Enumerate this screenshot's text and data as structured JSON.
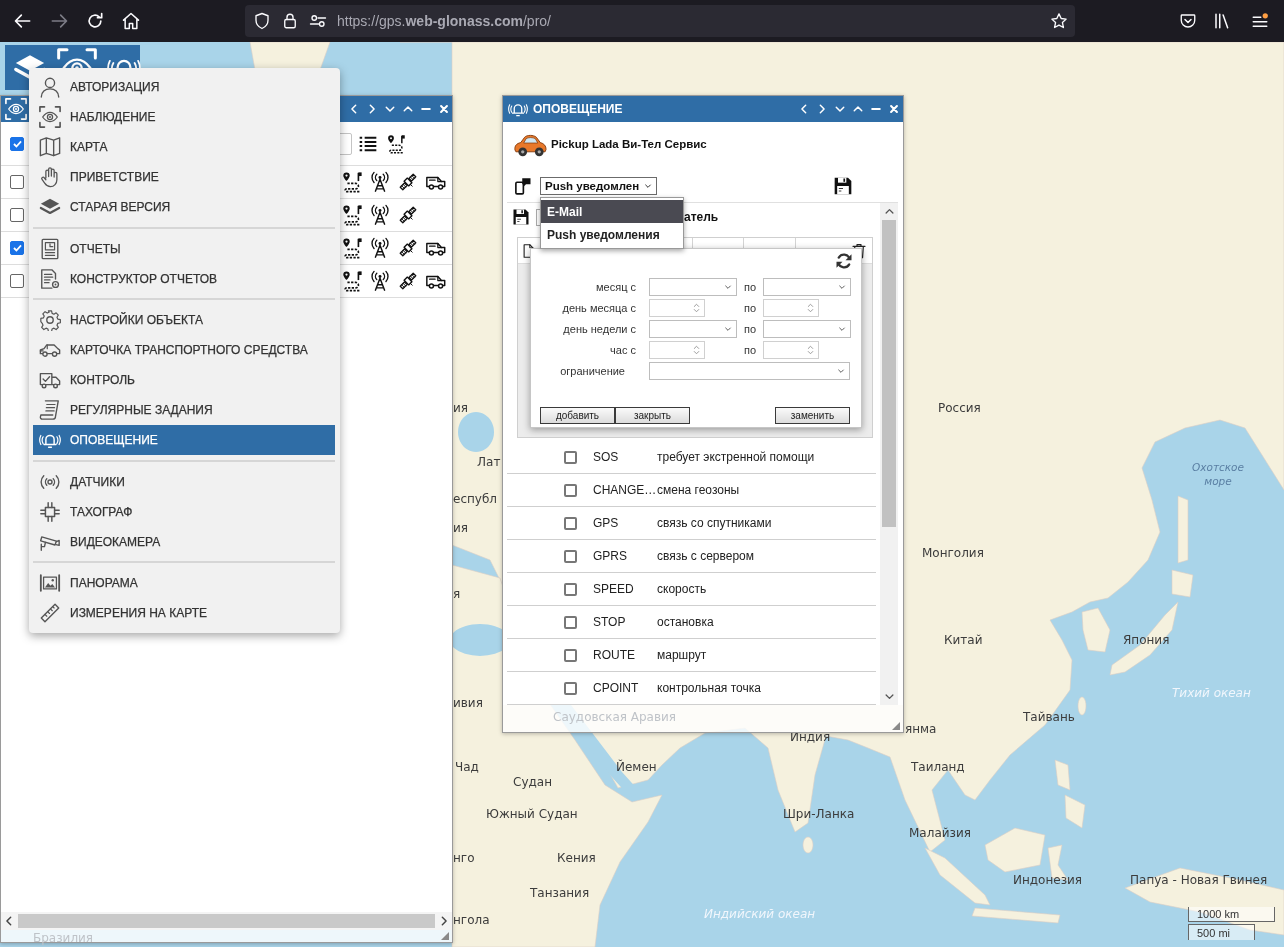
{
  "browser": {
    "url": "https://gps.**web-glonass.com**/pro/"
  },
  "objects_window": {
    "all_checked": true,
    "rows": [
      {
        "checked": false,
        "vehicle": true
      },
      {
        "checked": false,
        "vehicle": false
      },
      {
        "checked": true,
        "vehicle": true
      },
      {
        "checked": false,
        "vehicle": true
      }
    ]
  },
  "menu": {
    "groups": [
      {
        "items": [
          {
            "label": "АВТОРИЗАЦИЯ",
            "selected": false
          },
          {
            "label": "НАБЛЮДЕНИЕ",
            "selected": false
          },
          {
            "label": "КАРТА",
            "selected": false
          },
          {
            "label": "ПРИВЕТСТВИЕ",
            "selected": false
          },
          {
            "label": "СТАРАЯ ВЕРСИЯ",
            "selected": false
          }
        ]
      },
      {
        "items": [
          {
            "label": "ОТЧЕТЫ",
            "selected": false
          },
          {
            "label": "КОНСТРУКТОР ОТЧЕТОВ",
            "selected": false
          }
        ]
      },
      {
        "items": [
          {
            "label": "НАСТРОЙКИ ОБЪЕКТА",
            "selected": false
          },
          {
            "label": "КАРТОЧКА ТРАНСПОРТНОГО СРЕДСТВА",
            "selected": false
          },
          {
            "label": "КОНТРОЛЬ",
            "selected": false
          },
          {
            "label": "РЕГУЛЯРНЫЕ ЗАДАНИЯ",
            "selected": false
          },
          {
            "label": "ОПОВЕЩЕНИЕ",
            "selected": true
          }
        ]
      },
      {
        "items": [
          {
            "label": "ДАТЧИКИ",
            "selected": false
          },
          {
            "label": "ТАХОГРАФ",
            "selected": false
          },
          {
            "label": "ВИДЕОКАМЕРА",
            "selected": false
          }
        ]
      },
      {
        "items": [
          {
            "label": "ПАНОРАМА",
            "selected": false
          },
          {
            "label": "ИЗМЕРЕНИЯ НА КАРТЕ",
            "selected": false
          }
        ]
      }
    ]
  },
  "notification_window": {
    "title": "ОПОВЕЩЕНИЕ",
    "object_name": "Pickup Lada Ви-Тел Сервис",
    "channel": {
      "value": "Push уведомлен",
      "expanded": true,
      "options": [
        {
          "label": "E-Mail",
          "selected": true
        },
        {
          "label": "Push уведомления",
          "selected": false
        }
      ]
    },
    "recipient_label": "атель",
    "schedule": {
      "rows": [
        {
          "label": "месяц с",
          "kind": "select",
          "to_label": "по"
        },
        {
          "label": "день месяца с",
          "kind": "spinner",
          "to_label": "по"
        },
        {
          "label": "день недели с",
          "kind": "select",
          "to_label": "по"
        },
        {
          "label": "час с",
          "kind": "spinner",
          "to_label": "по"
        },
        {
          "label": "ограничение",
          "kind": "wide"
        }
      ],
      "buttons": [
        "добавить",
        "закрыть",
        "заменить"
      ]
    },
    "events": [
      {
        "code": "SOS",
        "description": "требует экстренной помощи",
        "checked": false
      },
      {
        "code": "CHANGE…",
        "description": "смена геозоны",
        "checked": false
      },
      {
        "code": "GPS",
        "description": "связь со спутниками",
        "checked": false
      },
      {
        "code": "GPRS",
        "description": "связь с сервером",
        "checked": false
      },
      {
        "code": "SPEED",
        "description": "скорость",
        "checked": false
      },
      {
        "code": "STOP",
        "description": "остановка",
        "checked": false
      },
      {
        "code": "ROUTE",
        "description": "маршрут",
        "checked": false
      },
      {
        "code": "CPOINT",
        "description": "контрольная точка",
        "checked": false
      }
    ]
  },
  "map": {
    "labels": [
      {
        "text": "ия",
        "kind": "country"
      },
      {
        "text": "Россия",
        "kind": "country"
      },
      {
        "text": "Лат",
        "kind": "country"
      },
      {
        "text": "Охотское море",
        "kind": "sea"
      },
      {
        "text": "еспубл",
        "kind": "country"
      },
      {
        "text": "ия",
        "kind": "country"
      },
      {
        "text": "Монголия",
        "kind": "country"
      },
      {
        "text": "я",
        "kind": "country"
      },
      {
        "text": "Китай",
        "kind": "country"
      },
      {
        "text": "Япония",
        "kind": "country"
      },
      {
        "text": "Тихий океан",
        "kind": "ocean"
      },
      {
        "text": "ивия",
        "kind": "country"
      },
      {
        "text": "Саудовская Аравия",
        "kind": "faded"
      },
      {
        "text": "Тайвань",
        "kind": "country"
      },
      {
        "text": "янма",
        "kind": "country"
      },
      {
        "text": "Индия",
        "kind": "country"
      },
      {
        "text": "Чад",
        "kind": "country"
      },
      {
        "text": "Йемен",
        "kind": "country"
      },
      {
        "text": "Таиланд",
        "kind": "country"
      },
      {
        "text": "Судан",
        "kind": "country"
      },
      {
        "text": "Южный Судан",
        "kind": "country"
      },
      {
        "text": "Шри-Ланка",
        "kind": "country"
      },
      {
        "text": "Малайзия",
        "kind": "country"
      },
      {
        "text": "нго",
        "kind": "country"
      },
      {
        "text": "Кения",
        "kind": "country"
      },
      {
        "text": "Индонезия",
        "kind": "country"
      },
      {
        "text": "Папуа - Новая Гвинея",
        "kind": "country"
      },
      {
        "text": "Танзания",
        "kind": "country"
      },
      {
        "text": "Индийский океан",
        "kind": "ocean"
      },
      {
        "text": "нгола",
        "kind": "country"
      },
      {
        "text": "Бразилия",
        "kind": "faded"
      }
    ],
    "scale": {
      "metric": "1000 km",
      "imperial": "500 mi"
    }
  }
}
